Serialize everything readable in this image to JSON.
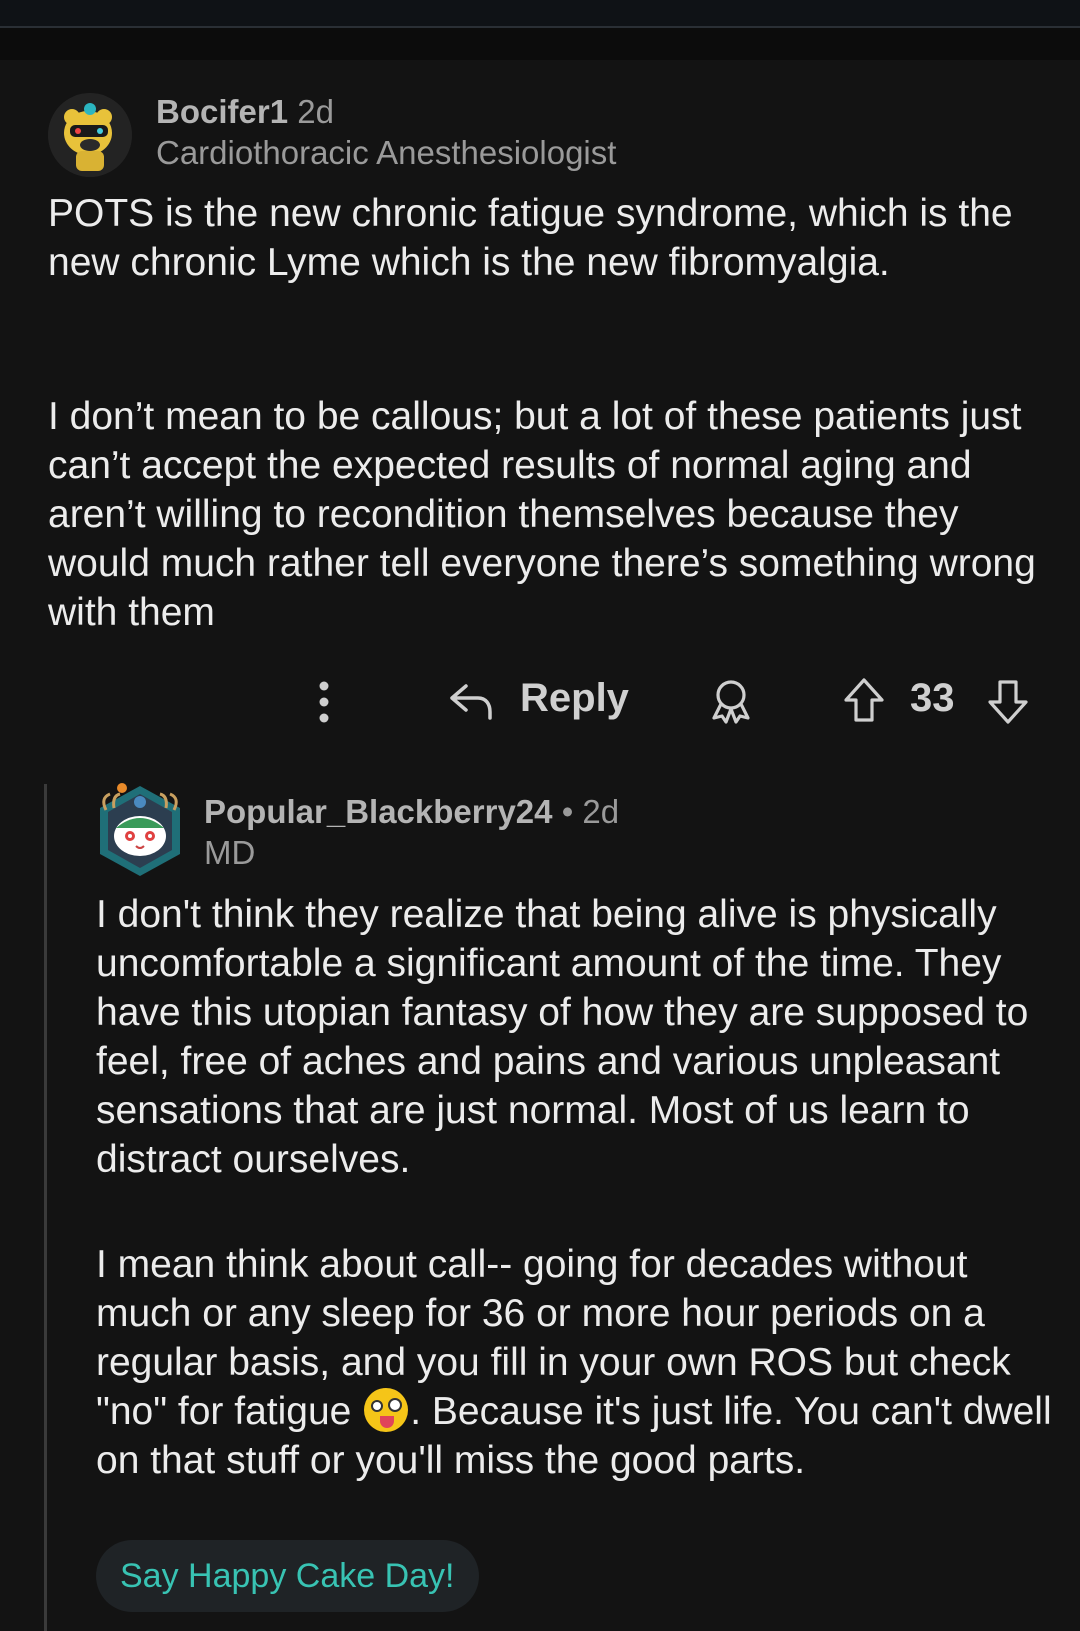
{
  "parent_comment": {
    "username": "Bocifer1",
    "age": "2d",
    "flair": "Cardiothoracic Anesthesiologist",
    "paragraphs": [
      "POTS is the new chronic fatigue syndrome, which is the new chronic Lyme which is the new fibromyalgia.",
      "I don’t mean to be callous; but a lot of these patients just can’t accept the expected results of normal aging and aren’t willing to recondition themselves because they would much rather tell everyone there’s something wrong with them"
    ],
    "actions": {
      "reply_label": "Reply",
      "score": "33"
    }
  },
  "reply_comment": {
    "username": "Popular_Blackberry24",
    "separator": "•",
    "age": "2d",
    "flair": "MD",
    "paragraphs": [
      "I don't think they realize that being alive is physically uncomfortable a significant amount of the time. They have this utopian fantasy of how they are supposed to feel, free of aches and pains and various unpleasant sensations that are just normal. Most of us learn to distract ourselves.",
      "I mean think about call-- going for decades without much or any sleep for 36 or more hour periods on a regular basis, and you fill in your own ROS but check \"no\" for fatigue",
      ". Because it's just life. You can't dwell on that stuff or you'll miss the good parts."
    ],
    "emoji": "zany-face-icon",
    "cake_day_button": "Say Happy Cake Day!"
  },
  "colors": {
    "background": "#131313",
    "text": "#ececec",
    "muted": "#9a9a9a",
    "accent": "#38c3b3"
  }
}
